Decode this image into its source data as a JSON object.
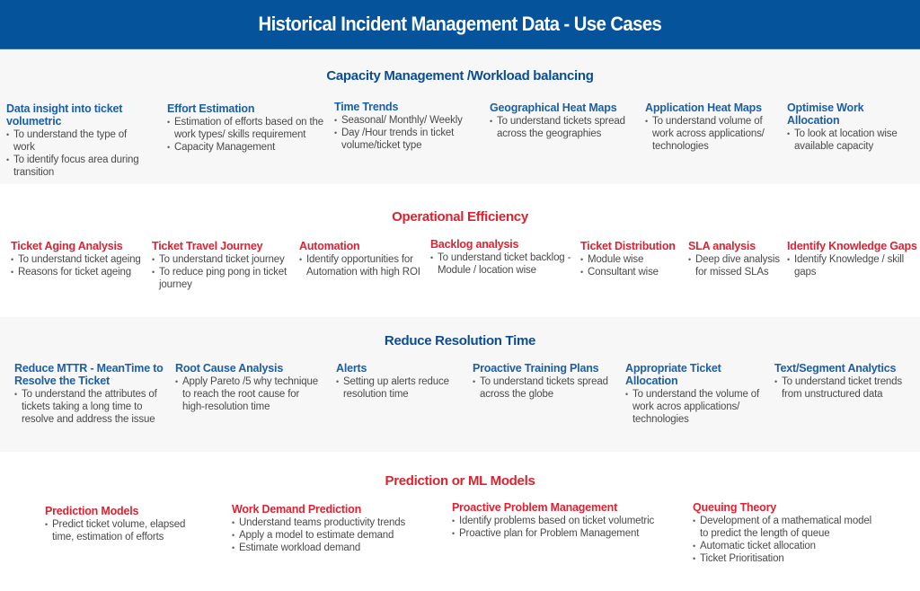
{
  "title": "Historical Incident Management Data - Use Cases",
  "colors": {
    "header_bg": "#04539b",
    "blue_accent": "#1a5fa8",
    "red_accent": "#de2232",
    "body_text": "#4a4a4a",
    "band_gray": "#f7f7f7"
  },
  "sections": [
    {
      "title": "Capacity Management /Workload balancing",
      "cards": [
        {
          "title": "Data insight into ticket volumetric",
          "bullets": [
            "To understand the type of work",
            "To identify focus area during transition"
          ]
        },
        {
          "title": "Effort Estimation",
          "bullets": [
            "Estimation of efforts based on the work types/ skills requirement",
            "Capacity Management"
          ]
        },
        {
          "title": "Time Trends",
          "bullets": [
            "Seasonal/ Monthly/ Weekly",
            "Day /Hour trends in ticket volume/ticket type"
          ]
        },
        {
          "title": "Geographical Heat Maps",
          "bullets": [
            "To understand tickets spread across the geographies"
          ]
        },
        {
          "title": "Application Heat Maps",
          "bullets": [
            "To understand volume of work across applications/ technologies"
          ]
        },
        {
          "title": "Optimise Work Allocation",
          "bullets": [
            "To look at location wise available capacity"
          ]
        }
      ]
    },
    {
      "title": "Operational Efficiency",
      "cards": [
        {
          "title": "Ticket Aging Analysis",
          "bullets": [
            "To understand ticket ageing",
            "Reasons for ticket ageing"
          ]
        },
        {
          "title": "Ticket Travel Journey",
          "bullets": [
            "To understand ticket journey",
            "To reduce ping pong in ticket journey"
          ]
        },
        {
          "title": "Automation",
          "bullets": [
            "Identify opportunities for Automation with high ROI"
          ]
        },
        {
          "title": "Backlog analysis",
          "bullets": [
            "To understand ticket backlog - Module / location wise"
          ]
        },
        {
          "title": "Ticket Distribution",
          "bullets": [
            "Module wise",
            "Consultant wise"
          ]
        },
        {
          "title": "SLA analysis",
          "bullets": [
            "Deep dive analysis for missed SLAs"
          ]
        },
        {
          "title": "Identify Knowledge Gaps",
          "bullets": [
            "Identify Knowledge / skill gaps"
          ]
        }
      ]
    },
    {
      "title": "Reduce Resolution Time",
      "cards": [
        {
          "title": "Reduce MTTR - MeanTime to Resolve the Ticket",
          "bullets": [
            "To understand the attributes of tickets taking a long time to resolve and address the issue"
          ]
        },
        {
          "title": "Root Cause Analysis",
          "bullets": [
            "Apply Pareto /5 why technique to reach the root cause for high-resolution time"
          ]
        },
        {
          "title": "Alerts",
          "bullets": [
            "Setting up alerts reduce resolution time"
          ]
        },
        {
          "title": "Proactive Training Plans",
          "bullets": [
            "To understand tickets spread across the globe"
          ]
        },
        {
          "title": "Appropriate Ticket Allocation",
          "bullets": [
            "To understand the volume of work acros applications/ technologies"
          ]
        },
        {
          "title": "Text/Segment Analytics",
          "bullets": [
            "To understand ticket trends from unstructured data"
          ]
        }
      ]
    },
    {
      "title": "Prediction or ML Models",
      "cards": [
        {
          "title": "Prediction Models",
          "bullets": [
            "Predict ticket volume, elapsed time, estimation of efforts"
          ]
        },
        {
          "title": "Work Demand Prediction",
          "bullets": [
            "Understand teams productivity trends",
            "Apply a model to estimate demand",
            "Estimate workload demand"
          ]
        },
        {
          "title": "Proactive Problem Management",
          "bullets": [
            "Identify problems based on ticket volumetric",
            "Proactive plan for Problem Management"
          ]
        },
        {
          "title": "Queuing Theory",
          "bullets": [
            "Development of a mathematical model to predict the length of queue",
            "Automatic ticket allocation",
            "Ticket Prioritisation"
          ]
        }
      ]
    }
  ]
}
